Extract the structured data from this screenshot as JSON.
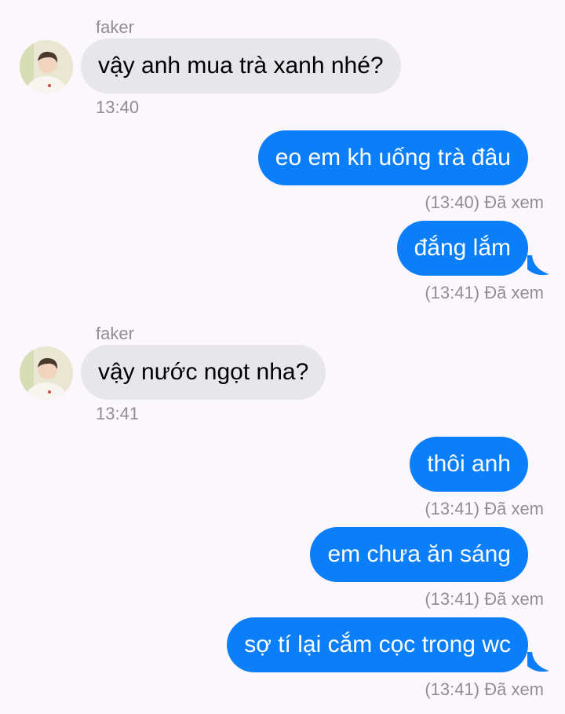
{
  "colors": {
    "background": "#fcf7fc",
    "incoming_bubble": "#e6e6eb",
    "outgoing_bubble": "#0b7ef9",
    "meta_text": "#8e8e93"
  },
  "messages": [
    {
      "direction": "incoming",
      "sender": "faker",
      "text": "vậy anh mua trà xanh nhé?",
      "time": "13:40"
    },
    {
      "direction": "outgoing",
      "text": "eo em kh uống trà đâu",
      "time": "(13:40)",
      "status": "Đã xem"
    },
    {
      "direction": "outgoing",
      "text": "đắng lắm",
      "time": "(13:41)",
      "status": "Đã xem"
    },
    {
      "direction": "incoming",
      "sender": "faker",
      "text": "vậy nước ngọt nha?",
      "time": "13:41"
    },
    {
      "direction": "outgoing",
      "text": "thôi anh",
      "time": "(13:41)",
      "status": "Đã xem"
    },
    {
      "direction": "outgoing",
      "text": "em chưa ăn sáng",
      "time": "(13:41)",
      "status": "Đã xem"
    },
    {
      "direction": "outgoing",
      "text": "sợ tí lại cắm cọc trong wc",
      "time": "(13:41)",
      "status": "Đã xem"
    }
  ]
}
